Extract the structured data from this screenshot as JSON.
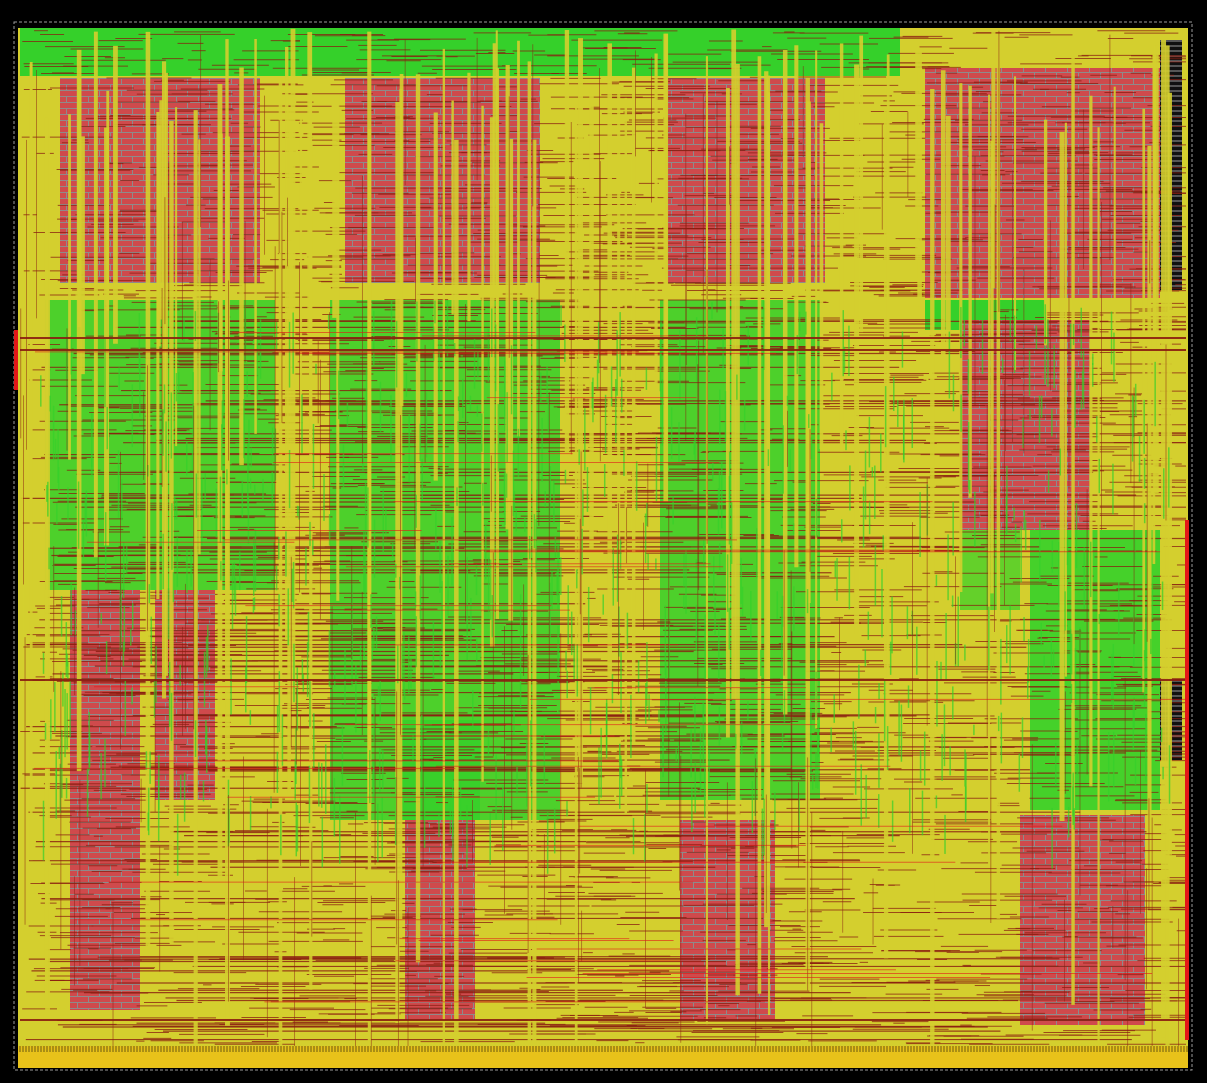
{
  "view": {
    "background_color": "#000000",
    "die_outline_color": "#9a9a9a"
  },
  "layers": {
    "cell_fill": "#d4cf2e",
    "routing_green": "#35d02a",
    "macro_fill": "#cf4a4c",
    "macro_grid": "#8f8a8a",
    "wire_dark_red": "#8a1d10",
    "wire_bright_red": "#e21818",
    "io_ring": "#e8c21a",
    "supply_line": "#9a9a9a"
  },
  "macro_labels": [
    {
      "name": "macro-label-1",
      "text": ""
    },
    {
      "name": "macro-label-2",
      "text": ""
    },
    {
      "name": "macro-label-3",
      "text": ""
    },
    {
      "name": "macro-label-4",
      "text": ""
    }
  ]
}
